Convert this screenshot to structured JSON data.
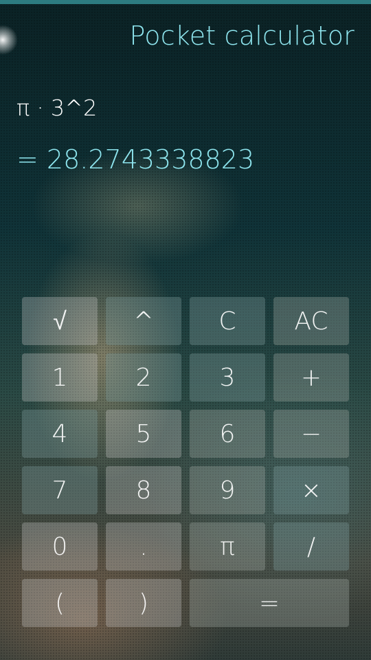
{
  "header": {
    "title": "Pocket calculator"
  },
  "display": {
    "expression": "π · 3^2",
    "result": "= 28.2743338823"
  },
  "keys": {
    "sqrt": "√",
    "pow": "^",
    "clear": "C",
    "all_clear": "AC",
    "one": "1",
    "two": "2",
    "three": "3",
    "plus": "+",
    "four": "4",
    "five": "5",
    "six": "6",
    "minus": "−",
    "seven": "7",
    "eight": "8",
    "nine": "9",
    "times": "×",
    "zero": "0",
    "dot": ".",
    "pi": "π",
    "divide": "/",
    "lparen": "(",
    "rparen": ")",
    "equals": "="
  },
  "colors": {
    "accent": "#8fe6ef",
    "top_bar": "#2d7b80"
  }
}
